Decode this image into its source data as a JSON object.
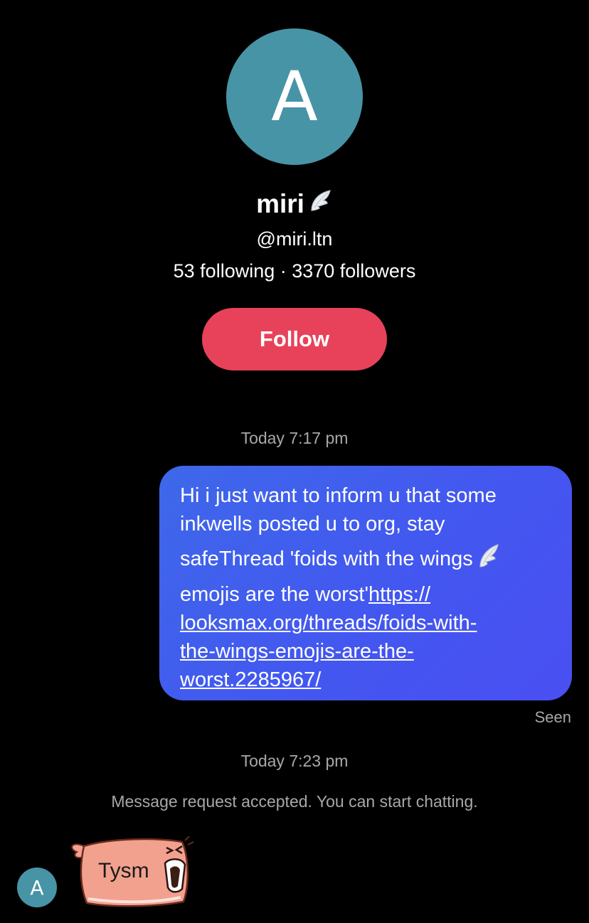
{
  "profile": {
    "avatar_initial": "A",
    "name": "miri",
    "name_emoji": "wing-icon",
    "handle": "@miri.ltn",
    "stats": "53 following · 3370 followers",
    "follow_label": "Follow"
  },
  "messages": {
    "timestamp_1": "Today 7:17 pm",
    "outgoing_text_line1": "Hi i just want to inform u that some",
    "outgoing_text_line2": "inkwells posted u to org, stay",
    "outgoing_text_line3": "safeThread 'foids with the wings",
    "outgoing_text_line4_pre": "emojis are the worst'",
    "outgoing_link_part1": "https://",
    "outgoing_link_part2": "looksmax.org/threads/foids-with-",
    "outgoing_link_part3": "the-wings-emojis-are-the-",
    "outgoing_link_part4": "worst.2285967/",
    "seen": "Seen",
    "timestamp_2": "Today 7:23 pm",
    "system_message": "Message request accepted. You can start chatting.",
    "incoming_avatar_initial": "A",
    "incoming_sticker_text": "Tysm"
  },
  "colors": {
    "background": "#000000",
    "avatar": "#4794a6",
    "follow_button": "#e8425a",
    "bubble_outgoing": "#4356f0",
    "muted_text": "#a8a8a8",
    "sticker_fill": "#f2a18f"
  }
}
